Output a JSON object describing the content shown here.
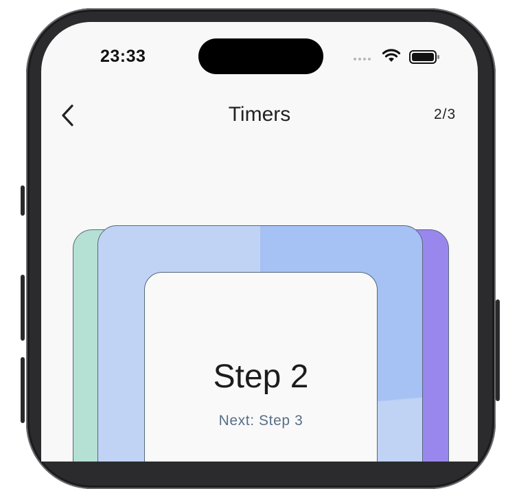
{
  "status_bar": {
    "time": "23:33"
  },
  "nav": {
    "title": "Timers",
    "counter": "2/3"
  },
  "card": {
    "title": "Step 2",
    "next": "Next: Step 3"
  },
  "colors": {
    "teal_card": "#b5e0d4",
    "blue_card_light": "#c0d3f4",
    "blue_card_dark": "#a6c1f3",
    "purple_card": "#9a87ee",
    "next_text": "#566e87"
  }
}
